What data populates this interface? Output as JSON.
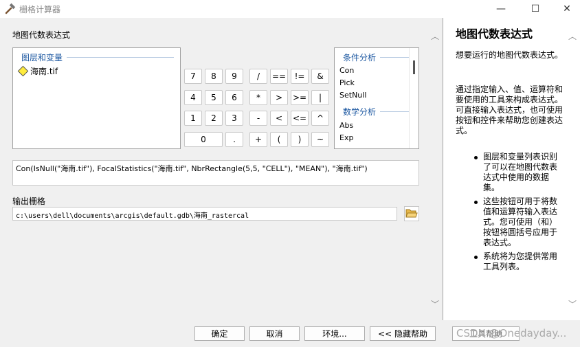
{
  "window": {
    "title": "栅格计算器",
    "controls": [
      "minimize",
      "maximize",
      "close"
    ]
  },
  "main": {
    "expression_label": "地图代数表达式",
    "layers_panel": {
      "header": "图层和变量",
      "items": [
        {
          "name": "海南.tif",
          "icon": "raster-layer-icon"
        }
      ]
    },
    "calculator": {
      "buttons": [
        "7",
        "8",
        "9",
        "/",
        "==",
        "!=",
        "&",
        "4",
        "5",
        "6",
        "*",
        ">",
        ">=",
        "|",
        "1",
        "2",
        "3",
        "-",
        "<",
        "<=",
        "^",
        "0",
        ".",
        "+",
        "(",
        ")",
        "~"
      ]
    },
    "functions_panel": {
      "groups": [
        {
          "header": "条件分析",
          "items": [
            "Con",
            "Pick",
            "SetNull"
          ]
        },
        {
          "header": "数学分析",
          "items": [
            "Abs",
            "Exp"
          ]
        }
      ]
    },
    "expression": "Con(IsNull(\"海南.tif\"), FocalStatistics(\"海南.tif\", NbrRectangle(5,5, \"CELL\"), \"MEAN\"), \"海南.tif\")",
    "output_label": "输出栅格",
    "output_path": "c:\\users\\dell\\documents\\arcgis\\default.gdb\\海南_rastercal"
  },
  "help": {
    "title": "地图代数表达式",
    "para1": "想要运行的地图代数表达式。",
    "para2": "通过指定输入、值、运算符和要使用的工具来构成表达式。可直接输入表达式，也可使用按钮和控件来帮助您创建表达式。",
    "bullets": [
      "图层和变量列表识别了可以在地图代数表达式中使用的数据集。",
      "这些按钮可用于将数值和运算符输入表达式。您可使用（和）按钮将圆括号应用于表达式。",
      "系统将为您提供常用工具列表。"
    ]
  },
  "footer": {
    "ok": "确定",
    "cancel": "取消",
    "env": "环境...",
    "hide_help": "<< 隐藏帮助",
    "tool_help": "工具帮助"
  },
  "watermark": "CSDN @Onedayday..."
}
